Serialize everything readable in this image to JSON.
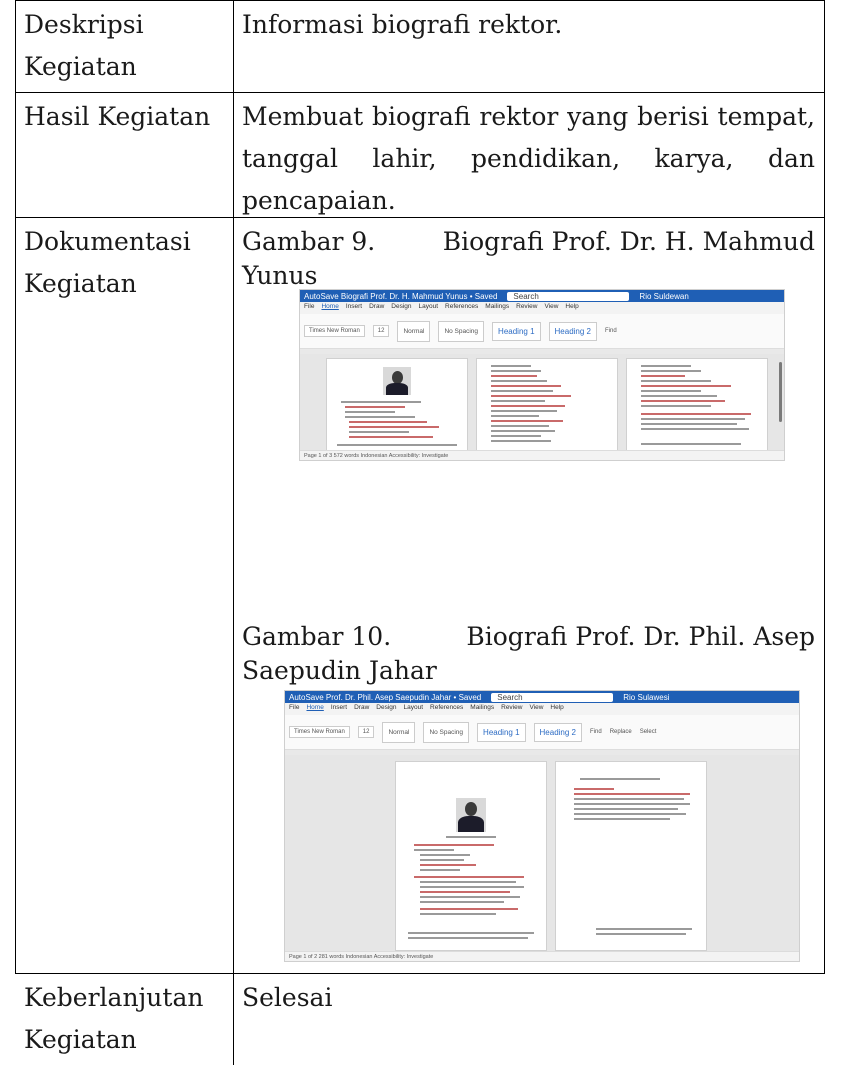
{
  "rows": [
    {
      "label": [
        "Deskripsi",
        "Kegiatan"
      ],
      "content": "Informasi biografi rektor."
    },
    {
      "label": [
        "Hasil Kegiatan"
      ],
      "content": "Membuat biografi rektor yang berisi tempat, tanggal lahir, pendidikan, karya, dan pencapaian."
    },
    {
      "label": [
        "Dokumentasi",
        "Kegiatan"
      ]
    },
    {
      "label": [
        "Keberlanjutan",
        "Kegiatan"
      ],
      "content": "Selesai"
    }
  ],
  "figures": [
    {
      "caption_prefix": "Gambar 9.",
      "caption_title_line1": "Biografi Prof. Dr. H. Mahmud",
      "caption_title_line2": "Yunus",
      "window_title": "AutoSave  Biografi Prof. Dr. H. Mahmud Yunus • Saved",
      "search": "Search",
      "user": "Rio Suldewan",
      "status": "Page 1 of 3   572 words   Indonesian      Accessibility: Investigate"
    },
    {
      "caption_prefix": "Gambar 10.",
      "caption_title_line1": "Biografi Prof. Dr. Phil. Asep",
      "caption_title_line2": "Saepudin Jahar",
      "window_title": "AutoSave  Prof. Dr. Phil. Asep Saepudin Jahar • Saved",
      "search": "Search",
      "user": "Rio Sulawesi",
      "status": "Page 1 of 2   281 words   Indonesian      Accessibility: Investigate"
    }
  ],
  "word_ui": {
    "menu": [
      "File",
      "Home",
      "Insert",
      "Draw",
      "Design",
      "Layout",
      "References",
      "Mailings",
      "Review",
      "View",
      "Help"
    ],
    "font_name": "Times New Roman",
    "font_size": "12",
    "styles": [
      "Normal",
      "No Spacing",
      "Heading 1",
      "Heading 2"
    ],
    "right_tools": [
      "Find",
      "Replace",
      "Select"
    ]
  }
}
